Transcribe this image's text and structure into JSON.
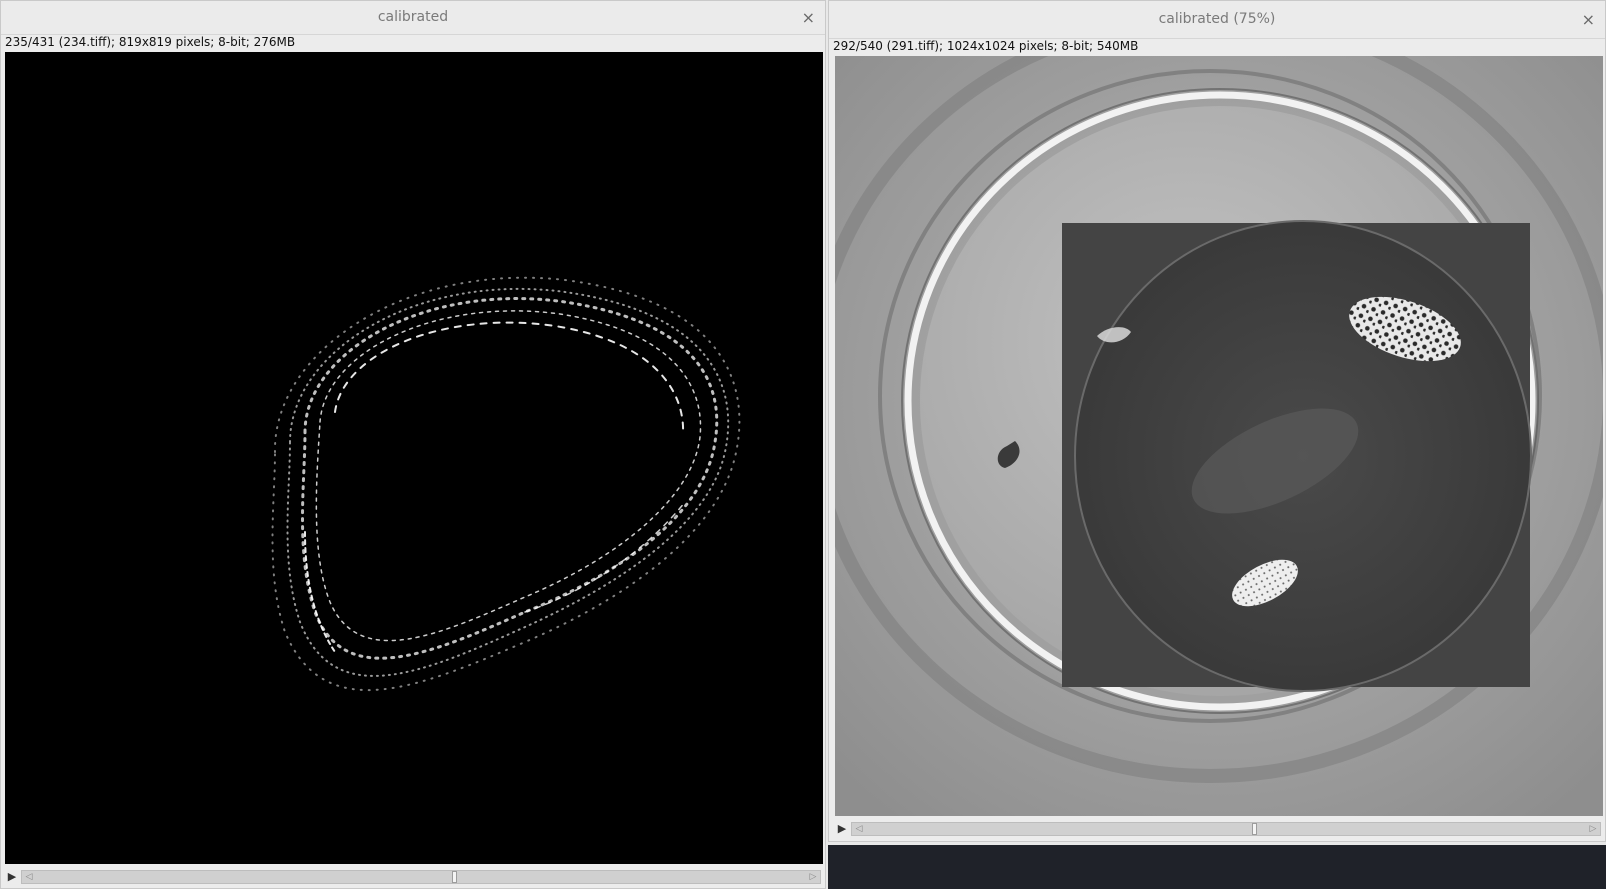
{
  "left_window": {
    "title": "calibrated",
    "close_glyph": "×",
    "status": "235/431 (234.tiff); 819x819 pixels; 8-bit; 276MB",
    "slice_current": 235,
    "slice_total": 431,
    "play_glyph": "▶",
    "scroll_left_glyph": "◁",
    "scroll_right_glyph": "▷"
  },
  "right_window": {
    "title": "calibrated (75%)",
    "close_glyph": "×",
    "status": "292/540 (291.tiff); 1024x1024 pixels; 8-bit; 540MB",
    "slice_current": 292,
    "slice_total": 540,
    "play_glyph": "▶",
    "scroll_left_glyph": "◁",
    "scroll_right_glyph": "▷"
  },
  "colors": {
    "left_canvas_bg": "#000000",
    "right_canvas_bg": "#9a9a9a",
    "overlay_bg": "#444444"
  },
  "icons": [
    "close-icon",
    "play-icon",
    "scroll-left-arrow-icon",
    "scroll-right-arrow-icon"
  ]
}
